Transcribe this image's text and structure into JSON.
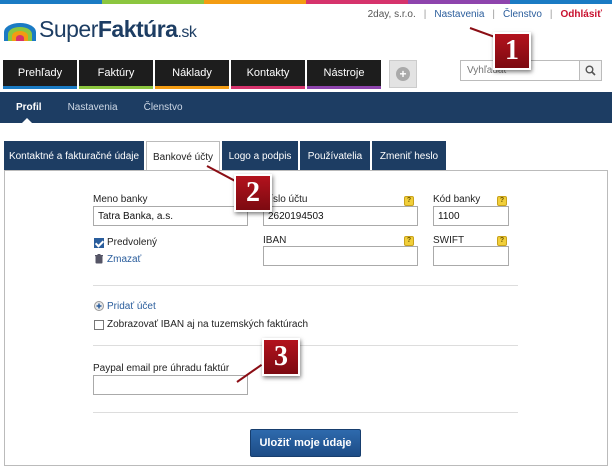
{
  "logo": {
    "light": "Super",
    "bold": "Faktúra",
    "tld": ".sk"
  },
  "toplinks": {
    "company": "2day, s.r.o.",
    "settings": "Nastavenia",
    "membership": "Členstvo",
    "logout": "Odhlásiť"
  },
  "mainnav": [
    {
      "label": "Prehľady",
      "accent": "#1a7bc4"
    },
    {
      "label": "Faktúry",
      "accent": "#8cc63f"
    },
    {
      "label": "Náklady",
      "accent": "#f39c12"
    },
    {
      "label": "Kontakty",
      "accent": "#d6336c"
    },
    {
      "label": "Nástroje",
      "accent": "#8e44ad"
    }
  ],
  "search": {
    "placeholder": "Vyhľadať"
  },
  "subnav": [
    "Profil",
    "Nastavenia",
    "Členstvo"
  ],
  "settingtabs": [
    "Kontaktné a fakturačné údaje",
    "Bankové účty",
    "Logo a podpis",
    "Používatelia",
    "Zmeniť heslo"
  ],
  "form": {
    "bank_name_label": "Meno banky",
    "bank_name_value": "Tatra Banka, a.s.",
    "account_label": "Číslo účtu",
    "account_value": "2620194503",
    "bank_code_label": "Kód banky",
    "bank_code_value": "1100",
    "default_label": "Predvolený",
    "delete_label": "Zmazať",
    "iban_label": "IBAN",
    "iban_value": "",
    "swift_label": "SWIFT",
    "swift_value": "",
    "add_account": "Pridať účet",
    "show_iban_label": "Zobrazovať IBAN aj na tuzemských faktúrach",
    "paypal_label": "Paypal email pre úhradu faktúr",
    "paypal_value": "",
    "help_glyph": "?",
    "save_label": "Uložiť moje údaje"
  },
  "callouts": [
    "1",
    "2",
    "3"
  ],
  "colors": {
    "navy": "#1d3d63",
    "link": "#2a5d9c",
    "logout": "#c8102e",
    "callout": "#a0101a"
  }
}
